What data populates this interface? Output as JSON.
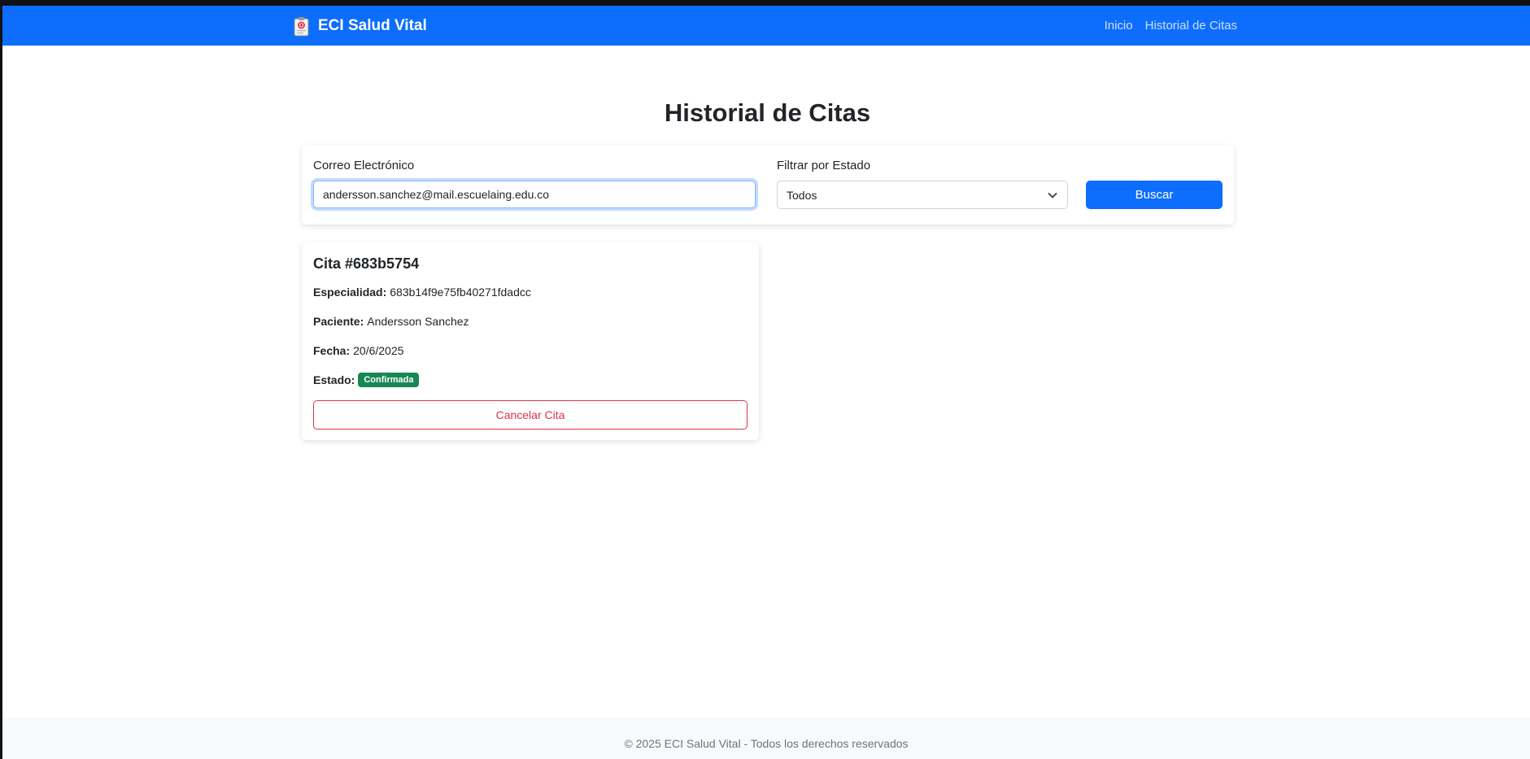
{
  "navbar": {
    "brand": "ECI Salud Vital",
    "brand_icon": "medical-clipboard-icon",
    "links": [
      {
        "label": "Inicio"
      },
      {
        "label": "Historial de Citas"
      }
    ]
  },
  "page": {
    "title": "Historial de Citas"
  },
  "filters": {
    "email_label": "Correo Electrónico",
    "email_value": "andersson.sanchez@mail.escuelaing.edu.co",
    "status_label": "Filtrar por Estado",
    "status_selected": "Todos",
    "search_button": "Buscar"
  },
  "appointment": {
    "title": "Cita #683b5754",
    "specialty_label": "Especialidad:",
    "specialty_value": "683b14f9e75fb40271fdadcc",
    "patient_label": "Paciente:",
    "patient_value": "Andersson Sanchez",
    "date_label": "Fecha:",
    "date_value": "20/6/2025",
    "status_label": "Estado:",
    "status_value": "Confirmada",
    "cancel_button": "Cancelar Cita"
  },
  "footer": {
    "text": "© 2025 ECI Salud Vital - Todos los derechos reservados"
  },
  "colors": {
    "primary": "#0d6efd",
    "success": "#198754",
    "danger": "#dc3545"
  }
}
